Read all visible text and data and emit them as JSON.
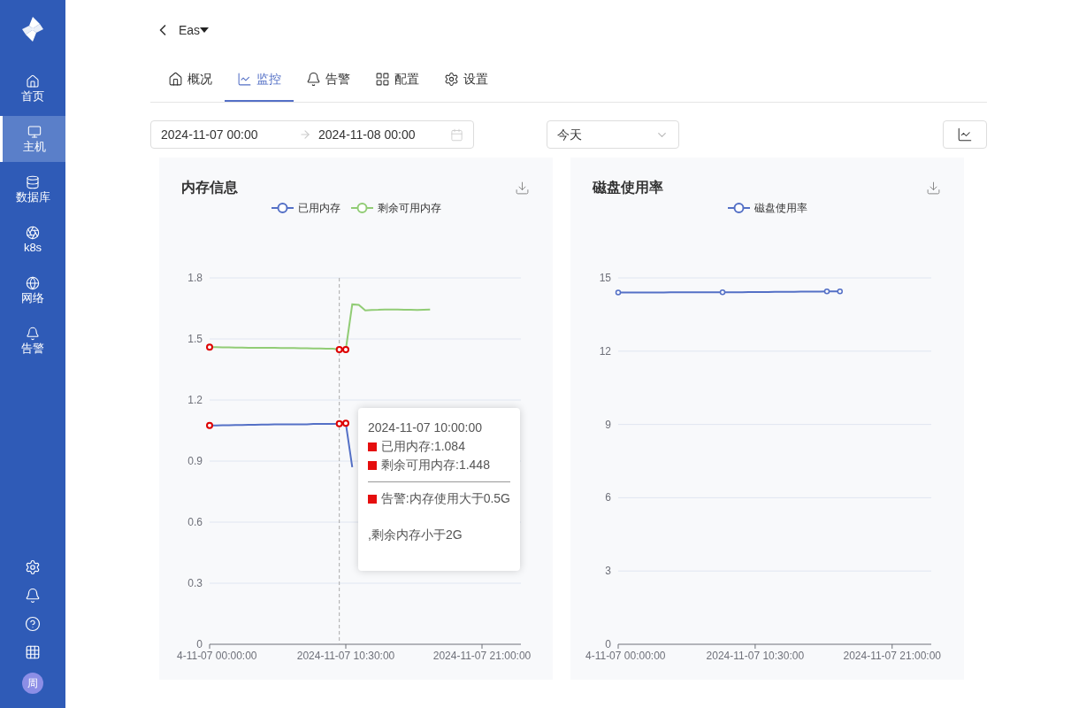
{
  "sidebar": {
    "items": [
      {
        "label": "首页",
        "selected": false
      },
      {
        "label": "主机",
        "selected": true
      },
      {
        "label": "数据库",
        "selected": false
      },
      {
        "label": "k8s",
        "selected": false
      },
      {
        "label": "网络",
        "selected": false
      },
      {
        "label": "告警",
        "selected": false
      }
    ],
    "avatar": "周"
  },
  "header": {
    "title": "Eas"
  },
  "tabs": [
    {
      "label": "概况",
      "selected": false
    },
    {
      "label": "监控",
      "selected": true
    },
    {
      "label": "告警",
      "selected": false
    },
    {
      "label": "配置",
      "selected": false
    },
    {
      "label": "设置",
      "selected": false
    }
  ],
  "filters": {
    "start": "2024-11-07 00:00",
    "end": "2024-11-08 00:00",
    "range": "今天"
  },
  "panels": [
    {
      "title": "内存信息",
      "chart_data": {
        "type": "line",
        "ylim": [
          0,
          1.8
        ],
        "categories": [
          "4-11-07 00:00:00",
          null,
          null,
          null,
          null,
          null,
          null,
          null,
          null,
          null,
          null,
          null,
          null,
          null,
          null,
          null,
          null,
          null,
          null,
          null,
          null,
          "2024-11-07 10:30:00",
          null,
          null,
          null,
          null,
          null,
          null,
          null,
          null,
          null,
          null,
          null,
          null,
          null,
          null,
          null,
          null,
          null,
          null,
          null,
          null,
          "2024-11-07 21:00:00",
          null,
          null,
          null,
          null,
          null
        ],
        "yticks": [
          {
            "value": 0,
            "label": "0"
          },
          {
            "value": 0.3,
            "label": "0.3"
          },
          {
            "value": 0.6,
            "label": "0.6"
          },
          {
            "value": 0.9,
            "label": "0.9"
          },
          {
            "value": 1.2,
            "label": "1.2"
          },
          {
            "value": 1.5,
            "label": "1.5"
          },
          {
            "value": 1.8,
            "label": "1.8"
          }
        ],
        "series": [
          {
            "name": "已用内存",
            "color": "#5470c6",
            "values": [
              1.075,
              1.075,
              1.076,
              1.076,
              1.077,
              1.077,
              1.078,
              1.078,
              1.079,
              1.079,
              1.08,
              1.08,
              1.08,
              1.081,
              1.081,
              1.081,
              1.082,
              1.082,
              1.082,
              1.083,
              1.084,
              1.086,
              0.87,
              null,
              null,
              null,
              null,
              null,
              null,
              null,
              null,
              null,
              null,
              null,
              null,
              null,
              null,
              null,
              null,
              null,
              null,
              null,
              null,
              null,
              null,
              null,
              null,
              null
            ]
          },
          {
            "name": "剩余可用内存",
            "color": "#91cc75",
            "values": [
              1.46,
              1.46,
              1.459,
              1.459,
              1.458,
              1.458,
              1.457,
              1.457,
              1.456,
              1.456,
              1.456,
              1.455,
              1.455,
              1.455,
              1.454,
              1.454,
              1.453,
              1.453,
              1.452,
              1.452,
              1.448,
              1.448,
              1.67,
              1.668,
              1.64,
              1.642,
              1.643,
              1.645,
              1.645,
              1.645,
              1.644,
              1.643,
              1.642,
              1.644,
              1.645,
              null,
              null,
              null,
              null,
              null,
              null,
              null,
              null,
              null,
              null,
              null,
              null,
              null
            ]
          }
        ],
        "grid": true
      },
      "tooltip": {
        "title": "2024-11-07 10:00:00",
        "items": [
          "已用内存:1.084",
          "剩余可用内存:1.448"
        ],
        "alerts": [
          "告警:内存使用大于0.5G"
        ],
        "note": ",剩余内存小于2G"
      }
    },
    {
      "title": "磁盘使用率",
      "chart_data": {
        "type": "line",
        "ylim": [
          0,
          15
        ],
        "categories": [
          "4-11-07 00:00:00",
          null,
          null,
          null,
          null,
          null,
          null,
          null,
          null,
          null,
          null,
          null,
          null,
          null,
          null,
          null,
          null,
          null,
          null,
          null,
          null,
          "2024-11-07 10:30:00",
          null,
          null,
          null,
          null,
          null,
          null,
          null,
          null,
          null,
          null,
          null,
          null,
          null,
          null,
          null,
          null,
          null,
          null,
          null,
          null,
          "2024-11-07 21:00:00",
          null,
          null,
          null,
          null,
          null
        ],
        "yticks": [
          {
            "value": 0,
            "label": "0"
          },
          {
            "value": 3,
            "label": "3"
          },
          {
            "value": 6,
            "label": "6"
          },
          {
            "value": 9,
            "label": "9"
          },
          {
            "value": 12,
            "label": "12"
          },
          {
            "value": 15,
            "label": "15"
          }
        ],
        "grid": true,
        "series": [
          {
            "name": "磁盘使用率",
            "color": "#5470c6",
            "values": [
              14.4,
              14.4,
              14.4,
              14.4,
              14.4,
              14.4,
              14.4,
              14.4,
              14.41,
              14.41,
              14.41,
              14.41,
              14.41,
              14.41,
              14.41,
              14.41,
              14.41,
              14.41,
              14.41,
              14.41,
              14.42,
              14.42,
              14.42,
              14.42,
              14.43,
              14.43,
              14.43,
              14.43,
              14.44,
              14.44,
              14.44,
              14.44,
              14.45,
              14.45,
              14.45,
              null,
              null,
              null,
              null,
              null,
              null,
              null,
              null,
              null,
              null,
              null,
              null,
              null
            ]
          }
        ]
      }
    }
  ]
}
